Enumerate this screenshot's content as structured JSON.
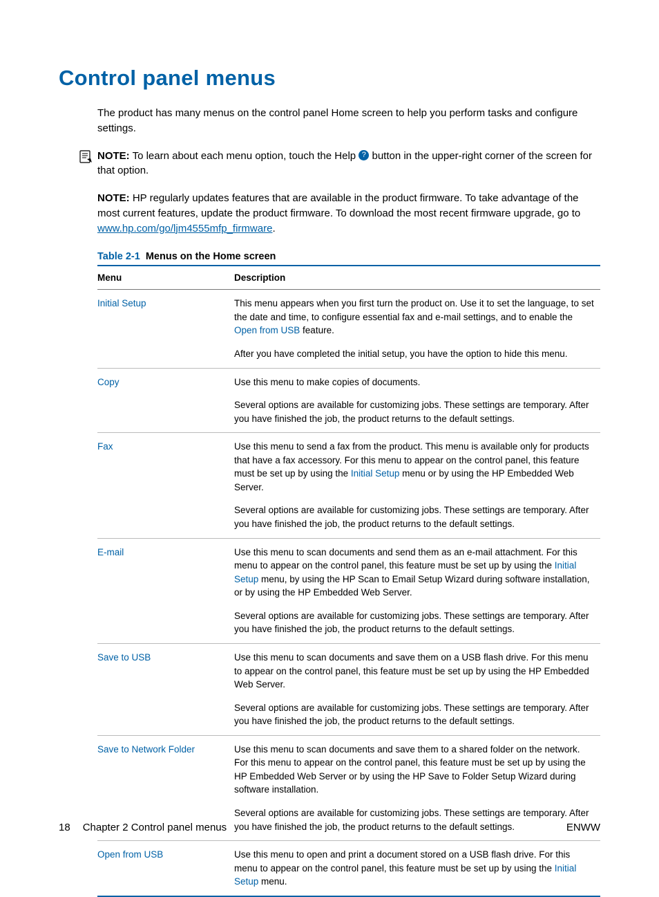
{
  "heading": "Control panel menus",
  "intro": "The product has many menus on the control panel Home screen to help you perform tasks and configure settings.",
  "note1": {
    "label": "NOTE:",
    "before": "To learn about each menu option, touch the Help ",
    "after": " button in the upper-right corner of the screen for that option."
  },
  "note2": {
    "label": "NOTE:",
    "before": "HP regularly updates features that are available in the product firmware. To take advantage of the most current features, update the product firmware. To download the most recent firmware upgrade, go to ",
    "link": "www.hp.com/go/ljm4555mfp_firmware",
    "after": "."
  },
  "table": {
    "caption_id": "Table 2-1",
    "caption_title": "Menus on the Home screen",
    "headers": {
      "menu": "Menu",
      "description": "Description"
    },
    "rows": [
      {
        "menu": "Initial Setup",
        "desc_html": "<p>This menu appears when you first turn the product on. Use it to set the language, to set the date and time, to configure essential fax and e-mail settings, and to enable the <span class=\"link-nounder\">Open from USB</span> feature.</p><p>After you have completed the initial setup, you have the option to hide this menu.</p>"
      },
      {
        "menu": "Copy",
        "desc_html": "<p>Use this menu to make copies of documents.</p><p>Several options are available for customizing jobs. These settings are temporary. After you have finished the job, the product returns to the default settings.</p>"
      },
      {
        "menu": "Fax",
        "desc_html": "<p>Use this menu to send a fax from the product. This menu is available only for products that have a fax accessory. For this menu to appear on the control panel, this feature must be set up by using the <span class=\"link-nounder\">Initial Setup</span> menu or by using the HP Embedded Web Server.</p><p>Several options are available for customizing jobs. These settings are temporary. After you have finished the job, the product returns to the default settings.</p>"
      },
      {
        "menu": "E-mail",
        "desc_html": "<p>Use this menu to scan documents and send them as an e-mail attachment. For this menu to appear on the control panel, this feature must be set up by using the <span class=\"link-nounder\">Initial Setup</span> menu, by using the HP Scan to Email Setup Wizard during software installation, or by using the HP Embedded Web Server.</p><p>Several options are available for customizing jobs. These settings are temporary. After you have finished the job, the product returns to the default settings.</p>"
      },
      {
        "menu": "Save to USB",
        "desc_html": "<p>Use this menu to scan documents and save them on a USB flash drive. For this menu to appear on the control panel, this feature must be set up by using the HP Embedded Web Server.</p><p>Several options are available for customizing jobs. These settings are temporary. After you have finished the job, the product returns to the default settings.</p>"
      },
      {
        "menu": "Save to Network Folder",
        "desc_html": "<p>Use this menu to scan documents and save them to a shared folder on the network. For this menu to appear on the control panel, this feature must be set up by using the HP Embedded Web Server or by using the HP Save to Folder Setup Wizard during software installation.</p><p>Several options are available for customizing jobs. These settings are temporary. After you have finished the job, the product returns to the default settings.</p>"
      },
      {
        "menu": "Open from USB",
        "desc_html": "<p>Use this menu to open and print a document stored on a USB flash drive. For this menu to appear on the control panel, this feature must be set up by using the <span class=\"link-nounder\">Initial Setup</span> menu.</p>"
      }
    ]
  },
  "footer": {
    "page_number": "18",
    "chapter": "Chapter 2   Control panel menus",
    "right": "ENWW"
  }
}
